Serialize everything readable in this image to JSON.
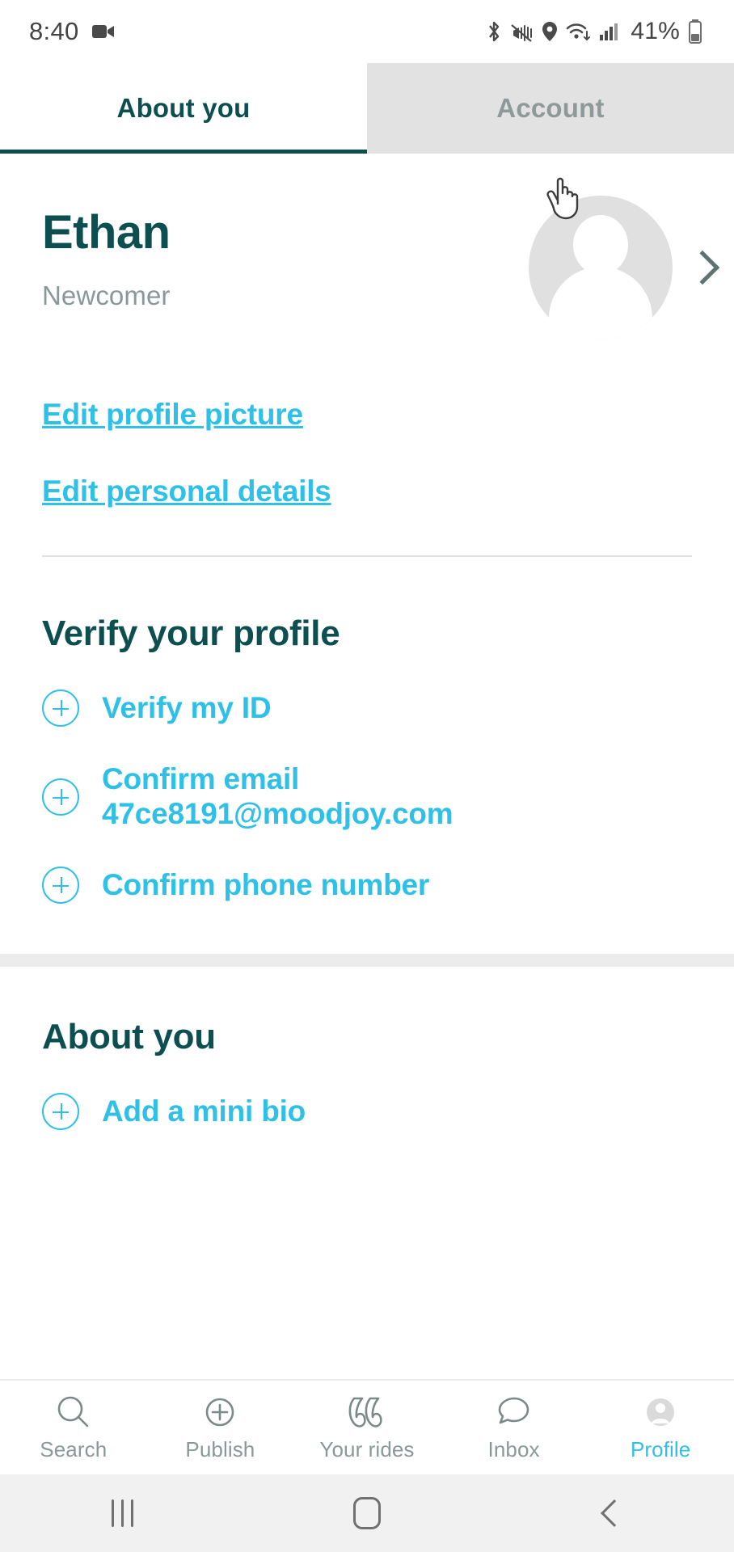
{
  "status_bar": {
    "time": "8:40",
    "battery_percent": "41%",
    "icons": [
      "video-camera-icon",
      "bluetooth-icon",
      "vibrate-mute-icon",
      "location-icon",
      "wifi-icon",
      "cellular-signal-icon",
      "battery-icon"
    ]
  },
  "tabs": [
    {
      "label": "About you",
      "active": true
    },
    {
      "label": "Account",
      "active": false
    }
  ],
  "profile": {
    "name": "Ethan",
    "status": "Newcomer",
    "avatar_alt": "default-avatar",
    "chevron": "chevron-right-icon"
  },
  "links": {
    "edit_profile_picture": "Edit profile picture",
    "edit_personal_details": "Edit personal details"
  },
  "verify_section": {
    "title": "Verify your profile",
    "items": [
      {
        "label": "Verify my ID",
        "icon": "plus-circle-icon"
      },
      {
        "label": "Confirm email 47ce8191@moodjoy.com",
        "icon": "plus-circle-icon"
      },
      {
        "label": "Confirm phone number",
        "icon": "plus-circle-icon"
      }
    ]
  },
  "about_section": {
    "title": "About you",
    "items": [
      {
        "label": "Add a mini bio",
        "icon": "plus-circle-icon"
      }
    ]
  },
  "bottom_nav": [
    {
      "label": "Search",
      "icon": "search-icon",
      "active": false
    },
    {
      "label": "Publish",
      "icon": "plus-circle-icon",
      "active": false
    },
    {
      "label": "Your rides",
      "icon": "rides-quotes-icon",
      "active": false
    },
    {
      "label": "Inbox",
      "icon": "speech-bubble-icon",
      "active": false
    },
    {
      "label": "Profile",
      "icon": "avatar-icon",
      "active": true
    }
  ],
  "android_nav": {
    "recents": "recents-button",
    "home": "home-button",
    "back": "back-button"
  },
  "colors": {
    "brand_dark": "#0d4f50",
    "accent_cyan": "#2fc0e8",
    "muted": "#8a9997",
    "tab_inactive_bg": "#e2e2e2"
  }
}
